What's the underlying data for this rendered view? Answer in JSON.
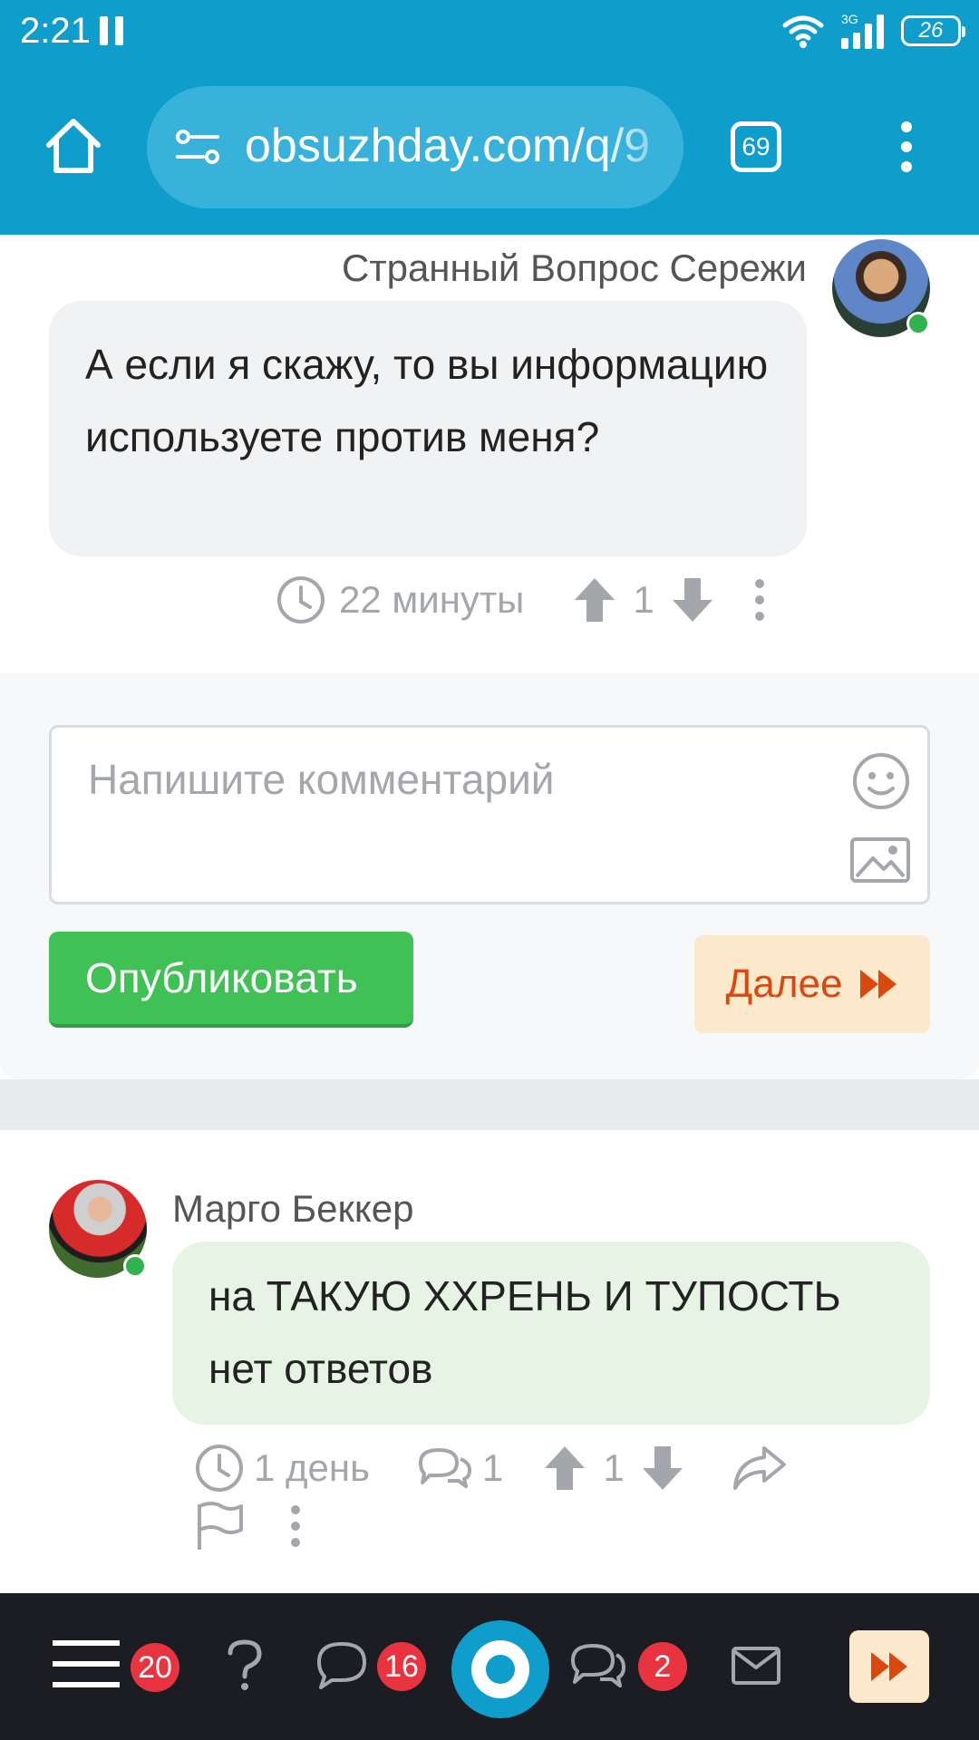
{
  "status_bar": {
    "time": "2:21",
    "network": "3G",
    "battery": "26"
  },
  "browser": {
    "url": "obsuzhday.com/q/9",
    "tab_count": "69"
  },
  "question": {
    "author": "Странный Вопрос Сережи",
    "text": "А если я скажу, то вы информацию используете против меня?",
    "time": "22 минуты",
    "votes": "1"
  },
  "comment_form": {
    "placeholder": "Напишите комментарий",
    "publish_label": "Опубликовать",
    "next_label": "Далее"
  },
  "answer": {
    "author": "Марго Беккер",
    "text": "на ТАКУЮ ХХРЕНЬ И ТУПОСТЬ нет ответов",
    "time": "1 день",
    "replies": "1",
    "votes": "1"
  },
  "bottom_nav": {
    "menu_badge": "20",
    "chat_badge": "16",
    "discussions_badge": "2"
  },
  "colors": {
    "brand": "#0f9dcc",
    "publish": "#3fc156",
    "next_bg": "#fde8cc",
    "next_fg": "#d9480f",
    "badge": "#e8343f"
  }
}
